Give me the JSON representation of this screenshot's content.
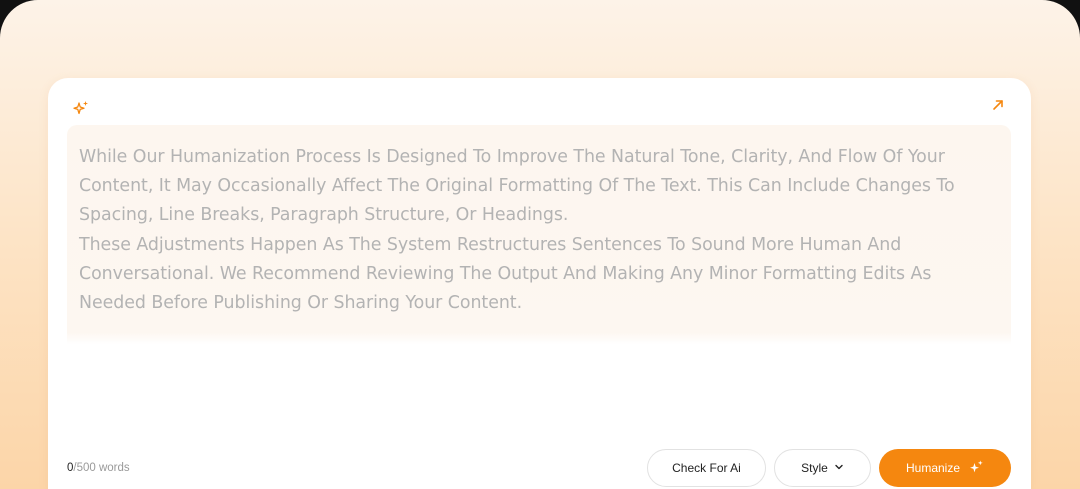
{
  "editor": {
    "paragraphs": [
      "While Our Humanization Process Is Designed To Improve The Natural Tone, Clarity, And Flow Of Your Content, It May Occasionally Affect The Original Formatting Of The Text. This Can Include Changes To Spacing, Line Breaks, Paragraph Structure, Or Headings.",
      "These Adjustments Happen As The System Restructures Sentences To Sound More Human And Conversational. We Recommend Reviewing The Output And Making Any Minor Formatting Edits As Needed Before Publishing Or Sharing Your Content."
    ]
  },
  "footer": {
    "word_count": "0",
    "word_limit": "/500 words",
    "check_label": "Check For Ai",
    "style_label": "Style",
    "humanize_label": "Humanize"
  },
  "colors": {
    "accent": "#f5870f",
    "placeholder_text": "#b3b3b3"
  },
  "icons": [
    "sparkle-icon",
    "expand-icon",
    "chevron-down-icon",
    "humanize-sparkle-icon"
  ]
}
